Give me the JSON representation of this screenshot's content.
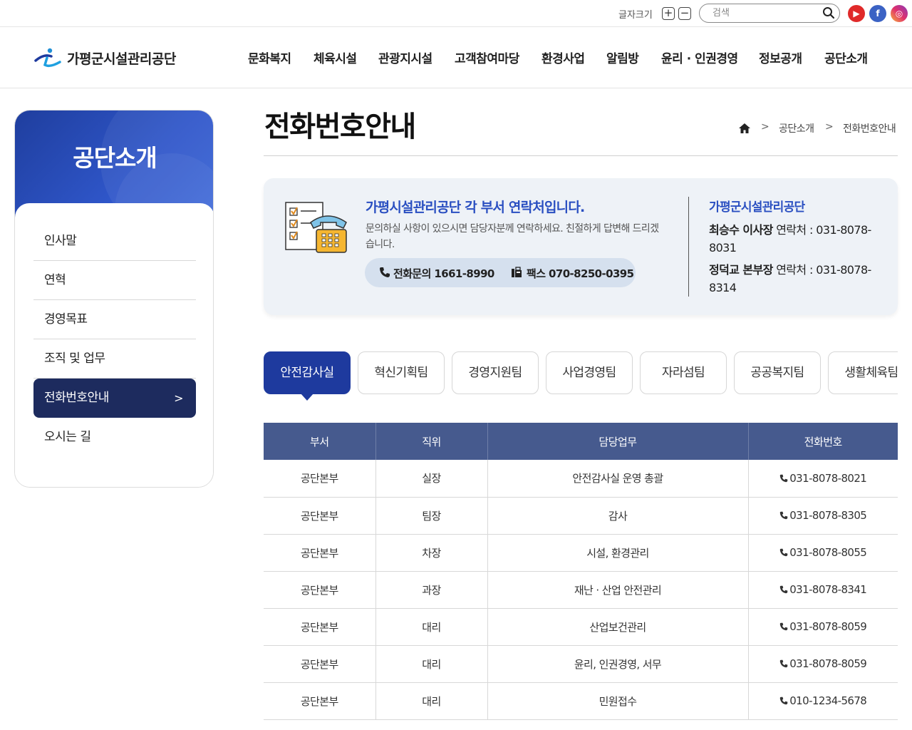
{
  "utility": {
    "font_size_label": "글자크기",
    "font_plus": "+",
    "font_minus": "−",
    "search_placeholder": "검색",
    "sns": [
      {
        "name": "youtube-icon",
        "glyph": "▶"
      },
      {
        "name": "facebook-icon",
        "glyph": "f"
      },
      {
        "name": "instagram-icon",
        "glyph": "◎"
      }
    ]
  },
  "header": {
    "logo_text": "가평군시설관리공단",
    "nav": [
      "문화복지",
      "체육시설",
      "관광지시설",
      "고객참여마당",
      "환경사업",
      "알림방",
      "윤리 · 인권경영",
      "정보공개",
      "공단소개"
    ]
  },
  "sidebar": {
    "title": "공단소개",
    "items": [
      {
        "label": "인사말"
      },
      {
        "label": "연혁"
      },
      {
        "label": "경영목표"
      },
      {
        "label": "조직 및 업무"
      },
      {
        "label": "전화번호안내",
        "active": true
      },
      {
        "label": "오시는 길"
      }
    ],
    "active_arrow": ">"
  },
  "main": {
    "title": "전화번호안내",
    "breadcrumb": [
      "공단소개",
      "전화번호안내"
    ],
    "breadcrumb_sep": ">",
    "info": {
      "heading": "가평시설관리공단 각 부서 연락처입니다.",
      "desc": "문의하실 사항이 있으시면 담당자분께 연락하세요. 친절하게 답변해 드리겠습니다.",
      "tel": "전화문의 1661-8990",
      "fax": "팩스 070-8250-0395",
      "org": "가평군시설관리공단",
      "contacts": [
        {
          "name": "최승수 이사장",
          "label": " 연락처 : 031-8078-8031"
        },
        {
          "name": "정덕교 본부장",
          "label": " 연락처 : 031-8078-8314"
        }
      ]
    },
    "tabs": [
      "안전감사실",
      "혁신기획팀",
      "경영지원팀",
      "사업경영팀",
      "자라섬팀",
      "공공복지팀",
      "생활체육팀"
    ],
    "table": {
      "headers": [
        "부서",
        "직위",
        "담당업무",
        "전화번호"
      ],
      "rows": [
        [
          "공단본부",
          "실장",
          "안전감사실 운영 총괄",
          "031-8078-8021"
        ],
        [
          "공단본부",
          "팀장",
          "감사",
          "031-8078-8305"
        ],
        [
          "공단본부",
          "차장",
          "시설, 환경관리",
          "031-8078-8055"
        ],
        [
          "공단본부",
          "과장",
          "재난 · 산업 안전관리",
          "031-8078-8341"
        ],
        [
          "공단본부",
          "대리",
          "산업보건관리",
          "031-8078-8059"
        ],
        [
          "공단본부",
          "대리",
          "윤리, 인권경영, 서무",
          "031-8078-8059"
        ],
        [
          "공단본부",
          "대리",
          "민원접수",
          "010-1234-5678"
        ]
      ]
    }
  },
  "colors": {
    "accent": "#1e3a9e",
    "sidebar_active": "#1d2b5e",
    "table_header": "#465a8e",
    "info_heading": "#2a4fc1"
  }
}
